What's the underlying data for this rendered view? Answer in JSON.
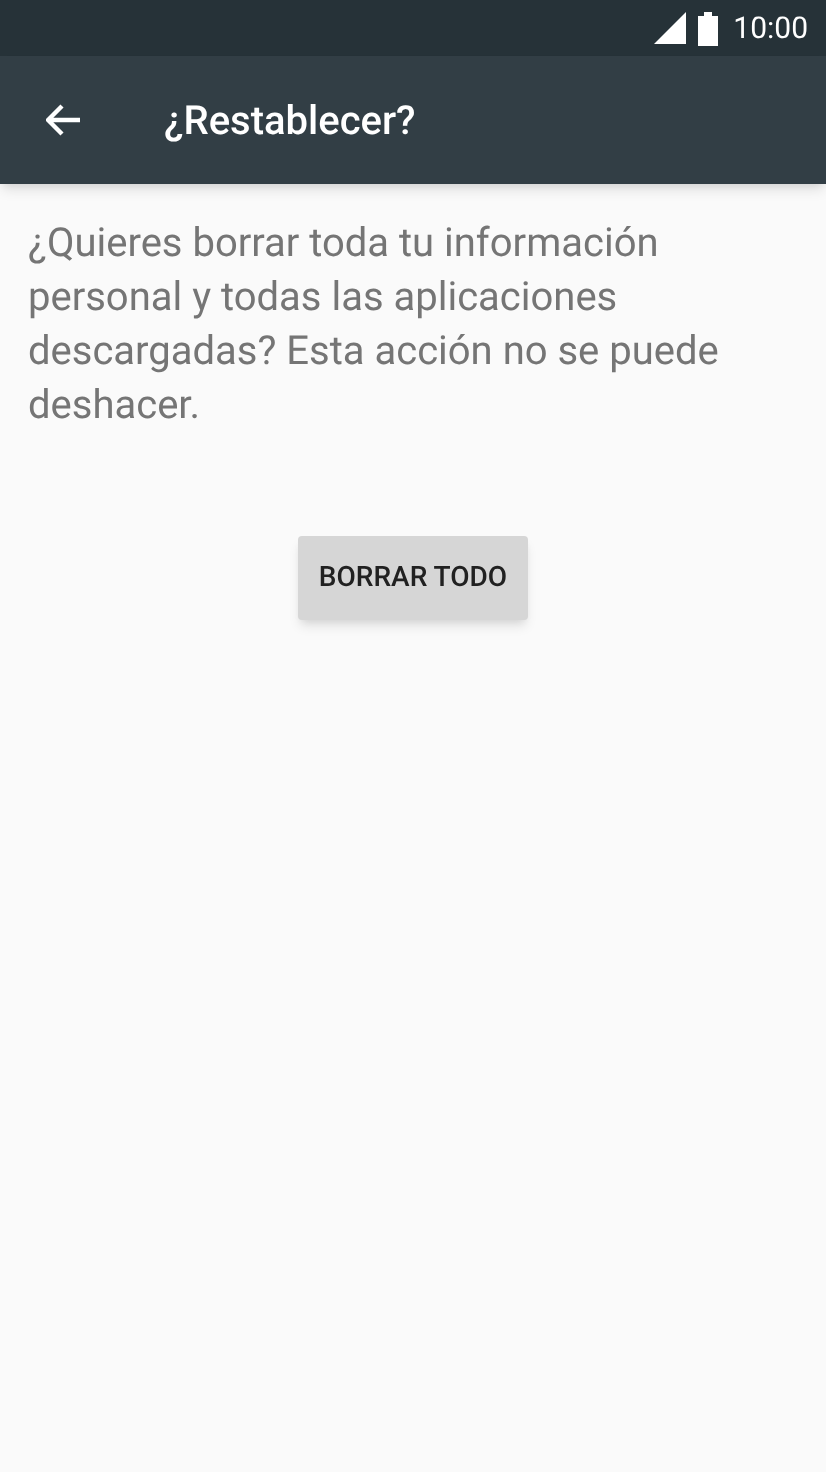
{
  "status_bar": {
    "time": "10:00"
  },
  "toolbar": {
    "title": "¿Restablecer?"
  },
  "message": "¿Quieres borrar toda tu información personal y todas las aplicaciones descargadas? Esta acción no se puede deshacer.",
  "buttons": [
    "BORRAR TODO"
  ]
}
